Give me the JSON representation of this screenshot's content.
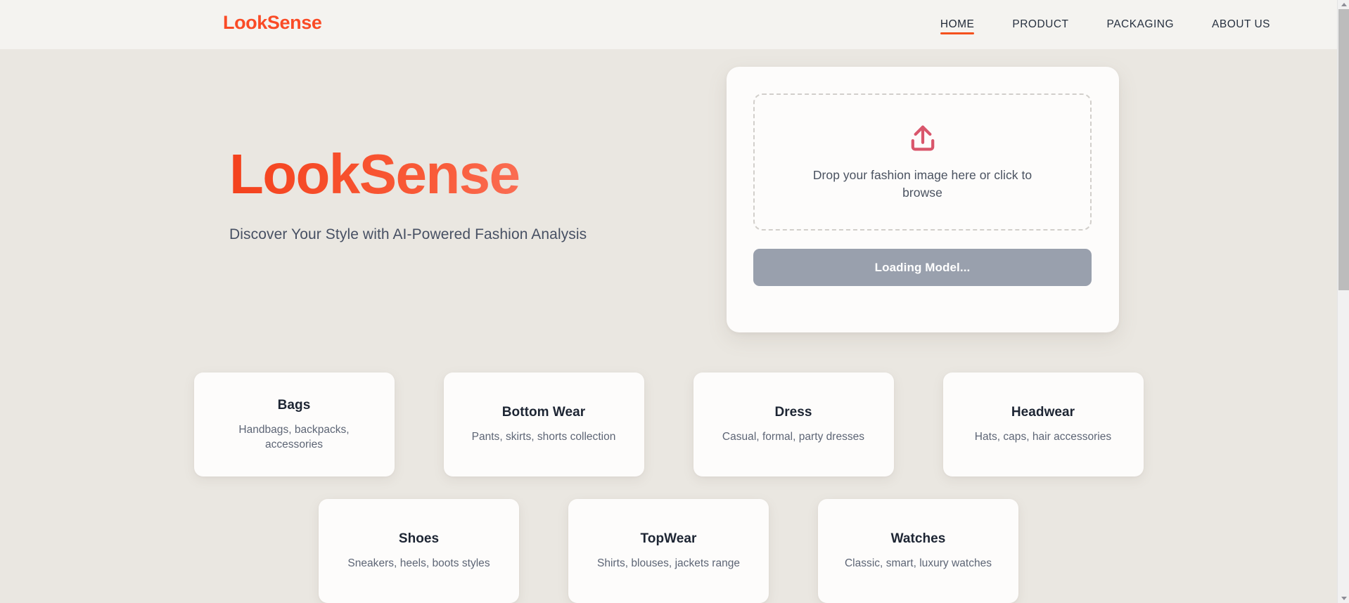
{
  "header": {
    "brand": "LookSense",
    "nav": [
      {
        "label": "HOME",
        "active": true
      },
      {
        "label": "PRODUCT",
        "active": false
      },
      {
        "label": "PACKAGING",
        "active": false
      },
      {
        "label": "ABOUT US",
        "active": false
      }
    ]
  },
  "hero": {
    "title": "LookSense",
    "subtitle": "Discover Your Style with AI-Powered Fashion Analysis"
  },
  "upload": {
    "icon": "upload-icon",
    "dropzone_text": "Drop your fashion image here or click to browse",
    "button_label": "Loading Model...",
    "button_state": "disabled"
  },
  "categories": [
    {
      "title": "Bags",
      "desc": "Handbags, backpacks, accessories"
    },
    {
      "title": "Bottom Wear",
      "desc": "Pants, skirts, shorts collection"
    },
    {
      "title": "Dress",
      "desc": "Casual, formal, party dresses"
    },
    {
      "title": "Headwear",
      "desc": "Hats, caps, hair accessories"
    },
    {
      "title": "Shoes",
      "desc": "Sneakers, heels, boots styles"
    },
    {
      "title": "TopWear",
      "desc": "Shirts, blouses, jackets range"
    },
    {
      "title": "Watches",
      "desc": "Classic, smart, luxury watches"
    }
  ],
  "colors": {
    "brand_orange": "#fa4b26",
    "accent_underline": "#f4511e",
    "upload_icon": "#d9566b",
    "button_gray": "#99a0ad",
    "page_bg": "#eae7e1",
    "header_bg": "#f4f3f0",
    "card_bg": "#fdfcfb",
    "heading_dark": "#1d2533"
  }
}
